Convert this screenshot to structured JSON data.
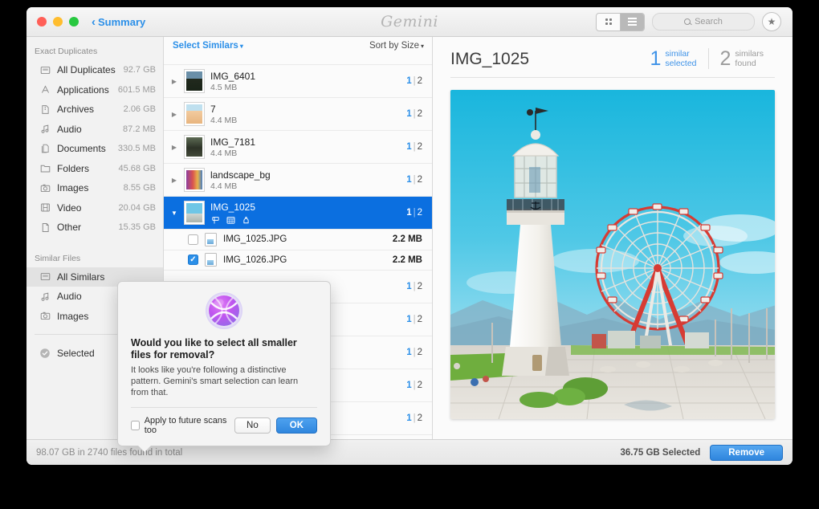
{
  "titlebar": {
    "back_label": "Summary",
    "app_name": "Gemini",
    "search_placeholder": "Search",
    "icons": {
      "grid_view": "grid-view-icon",
      "list_view": "list-view-icon",
      "search": "search-icon",
      "star": "★"
    }
  },
  "sidebar": {
    "section_exact": "Exact Duplicates",
    "exact_items": [
      {
        "label": "All Duplicates",
        "size": "92.7 GB",
        "icon": "all-duplicates-icon"
      },
      {
        "label": "Applications",
        "size": "601.5 MB",
        "icon": "applications-icon"
      },
      {
        "label": "Archives",
        "size": "2.06 GB",
        "icon": "archives-icon"
      },
      {
        "label": "Audio",
        "size": "87.2 MB",
        "icon": "audio-icon"
      },
      {
        "label": "Documents",
        "size": "330.5 MB",
        "icon": "documents-icon"
      },
      {
        "label": "Folders",
        "size": "45.68 GB",
        "icon": "folders-icon"
      },
      {
        "label": "Images",
        "size": "8.55 GB",
        "icon": "images-icon"
      },
      {
        "label": "Video",
        "size": "20.04 GB",
        "icon": "video-icon"
      },
      {
        "label": "Other",
        "size": "15.35 GB",
        "icon": "other-icon"
      }
    ],
    "section_similar": "Similar Files",
    "similar_items": [
      {
        "label": "All Similars",
        "size": "",
        "icon": "all-similars-icon",
        "selected": true
      },
      {
        "label": "Audio",
        "size": "",
        "icon": "audio-icon",
        "selected": false
      },
      {
        "label": "Images",
        "size": "",
        "icon": "images-icon",
        "selected": false
      }
    ],
    "selected_item": {
      "label": "Selected",
      "icon": "selected-check-icon"
    }
  },
  "list": {
    "select_similars_label": "Select Similars",
    "sort_label": "Sort by Size",
    "caret": "▾",
    "rows": [
      {
        "name": "IMG_6401",
        "size": "4.5 MB",
        "selected_count": "1",
        "total_count": "2",
        "expanded": false,
        "thumb": "dark-landscape"
      },
      {
        "name": "7",
        "size": "4.4 MB",
        "selected_count": "1",
        "total_count": "2",
        "expanded": false,
        "thumb": "poster"
      },
      {
        "name": "IMG_7181",
        "size": "4.4 MB",
        "selected_count": "1",
        "total_count": "2",
        "expanded": false,
        "thumb": "dark-portrait"
      },
      {
        "name": "landscape_bg",
        "size": "4.4 MB",
        "selected_count": "1",
        "total_count": "2",
        "expanded": false,
        "thumb": "colorful"
      },
      {
        "name": "IMG_1025",
        "size": "",
        "selected_count": "1",
        "total_count": "2",
        "expanded": true,
        "thumb": "lighthouse",
        "selected": true
      }
    ],
    "subrows": [
      {
        "name": "IMG_1025.JPG",
        "size": "2.2 MB",
        "checked": false
      },
      {
        "name": "IMG_1026.JPG",
        "size": "2.2 MB",
        "checked": true
      }
    ],
    "hidden_rows": [
      {
        "selected_count": "1",
        "total_count": "2"
      },
      {
        "selected_count": "1",
        "total_count": "2"
      },
      {
        "selected_count": "1",
        "total_count": "2"
      },
      {
        "selected_count": "1",
        "total_count": "2"
      },
      {
        "selected_count": "1",
        "total_count": "2"
      }
    ],
    "badge_icons": [
      "signpost-icon",
      "calendar-icon",
      "bell-icon"
    ]
  },
  "preview": {
    "title": "IMG_1025",
    "similar_selected_num": "1",
    "similar_selected_line1": "similar",
    "similar_selected_line2": "selected",
    "similars_found_num": "2",
    "similars_found_line1": "similars",
    "similars_found_line2": "found",
    "image_alt": "lighthouse-and-ferris-wheel-photo"
  },
  "statusbar": {
    "total_text": "98.07 GB in 2740 files found in total",
    "selected_text": "36.75 GB Selected",
    "remove_label": "Remove"
  },
  "dialog": {
    "title": "Would you like to select all smaller files for removal?",
    "body": "It looks like you're following a distinctive pattern. Gemini's smart selection can learn from that.",
    "checkbox_label": "Apply to future scans too",
    "no_label": "No",
    "ok_label": "OK",
    "icon": "gemini-orb-icon"
  },
  "colors": {
    "accent_blue": "#2b8fe8",
    "selection_blue": "#0b6fe0",
    "orb_purple": "#b24cf0"
  }
}
